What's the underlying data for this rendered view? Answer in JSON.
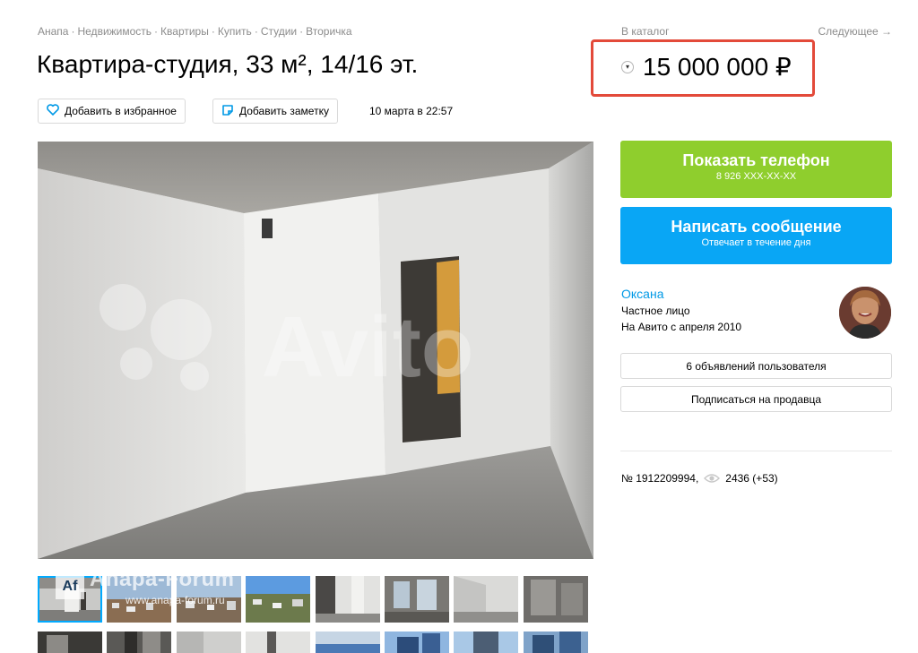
{
  "breadcrumb": {
    "items": [
      "Анапа",
      "Недвижимость",
      "Квартиры",
      "Купить",
      "Студии",
      "Вторичка"
    ],
    "separator": "·"
  },
  "nav": {
    "catalog": "В каталог",
    "next": "Следующее →"
  },
  "listing": {
    "title": "Квартира-студия, 33 м², 14/16 эт.",
    "price": "15 000 000 ₽",
    "price_dropdown_icon": "chevron-down-icon",
    "date": "10 марта в 22:57",
    "number": "№ 1912209994,",
    "views": "2436 (+53)"
  },
  "actions": {
    "favorite_label": "Добавить в избранное",
    "note_label": "Добавить заметку"
  },
  "contact": {
    "phone_title": "Показать телефон",
    "phone_masked": "8 926 XXX-XX-XX",
    "message_title": "Написать сообщение",
    "message_sub": "Отвечает в течение дня"
  },
  "seller": {
    "name": "Оксана",
    "type": "Частное лицо",
    "since": "На Авито с апреля 2010",
    "ads_label": "6 объявлений пользователя",
    "subscribe_label": "Подписаться на продавца"
  },
  "gallery": {
    "watermark": {
      "badge": "Af",
      "title": "Anapa-Forum",
      "url": "www.anapa-forum.ru"
    },
    "photo_watermark": "Avito"
  },
  "colors": {
    "accent_blue": "#09a6f5",
    "phone_green": "#8fce2d",
    "link_blue": "#0099e6",
    "highlight_red": "#e34a3a"
  }
}
